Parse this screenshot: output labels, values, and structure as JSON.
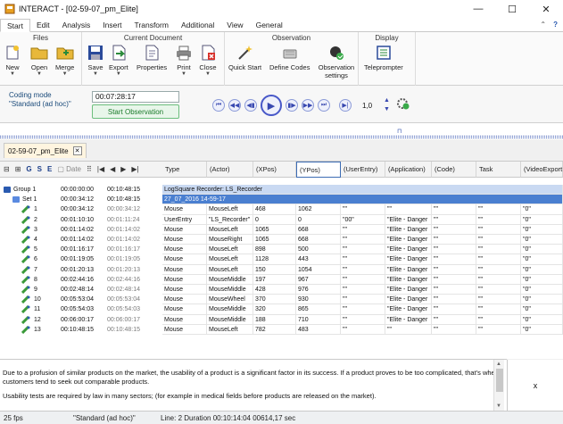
{
  "window": {
    "title": "INTERACT - [02-59-07_pm_Elite]",
    "minimize": "—",
    "maximize": "☐",
    "close": "✕"
  },
  "menu": {
    "tabs": [
      "Start",
      "Edit",
      "Analysis",
      "Insert",
      "Transform",
      "Additional",
      "View",
      "General"
    ],
    "help_icons": [
      "⌃",
      "?"
    ]
  },
  "ribbon": {
    "groups": {
      "files": "Files",
      "current_document": "Current Document",
      "observation": "Observation",
      "display": "Display"
    },
    "buttons": {
      "new": "New",
      "open": "Open",
      "merge": "Merge",
      "save": "Save",
      "export": "Export",
      "properties": "Properties",
      "print": "Print",
      "close": "Close",
      "quick_start": "Quick Start",
      "define_codes": "Define Codes",
      "observation_settings": "Observation settings",
      "teleprompter": "Teleprompter"
    }
  },
  "playback": {
    "coding_mode_label": "Coding mode",
    "coding_mode_value": "\"Standard (ad hoc)\"",
    "time": "00:07:28:17",
    "start_observation": "Start Observation",
    "speed": "1,0"
  },
  "document_tab": {
    "name": "02-59-07_pm_Elite"
  },
  "grid": {
    "toolbar": {
      "date_label": "Date"
    },
    "columns": [
      "Type",
      "(Actor)",
      "(XPos)",
      "(YPos)",
      "(UserEntry)",
      "(Application)",
      "(Code)",
      "Task",
      "(VideoExport"
    ],
    "group_row": {
      "label": "Group 1",
      "start": "00:00:00:00",
      "end": "00:10:48:15",
      "text": "LogSquare Recorder: LS_Recorder"
    },
    "set_row": {
      "label": "Set 1",
      "start": "00:00:34:12",
      "end": "00:10:48:15",
      "text": "27_07_2016 14-59-17"
    },
    "rows": [
      {
        "n": "1",
        "start": "00:00:34:12",
        "end": "00:00:34:12",
        "cells": [
          "Mouse",
          "MouseLeft",
          "468",
          "1062",
          "\"\"",
          "\"\"",
          "\"\"",
          "\"\"",
          "\"0\""
        ]
      },
      {
        "n": "2",
        "start": "00:01:10:10",
        "end": "00:01:11:24",
        "cells": [
          "UserEntry",
          "\"LS_Recorder\"",
          "0",
          "0",
          "\"00\"",
          "\"Elite - Danger",
          "\"\"",
          "\"\"",
          "\"0\""
        ]
      },
      {
        "n": "3",
        "start": "00:01:14:02",
        "end": "00:01:14:02",
        "cells": [
          "Mouse",
          "MouseLeft",
          "1065",
          "668",
          "\"\"",
          "\"Elite - Danger",
          "\"\"",
          "\"\"",
          "\"0\""
        ]
      },
      {
        "n": "4",
        "start": "00:01:14:02",
        "end": "00:01:14:02",
        "cells": [
          "Mouse",
          "MouseRight",
          "1065",
          "668",
          "\"\"",
          "\"Elite - Danger",
          "\"\"",
          "\"\"",
          "\"0\""
        ]
      },
      {
        "n": "5",
        "start": "00:01:16:17",
        "end": "00:01:16:17",
        "cells": [
          "Mouse",
          "MouseLeft",
          "898",
          "500",
          "\"\"",
          "\"Elite - Danger",
          "\"\"",
          "\"\"",
          "\"0\""
        ]
      },
      {
        "n": "6",
        "start": "00:01:19:05",
        "end": "00:01:19:05",
        "cells": [
          "Mouse",
          "MouseLeft",
          "1128",
          "443",
          "\"\"",
          "\"Elite - Danger",
          "\"\"",
          "\"\"",
          "\"0\""
        ]
      },
      {
        "n": "7",
        "start": "00:01:20:13",
        "end": "00:01:20:13",
        "cells": [
          "Mouse",
          "MouseLeft",
          "150",
          "1054",
          "\"\"",
          "\"Elite - Danger",
          "\"\"",
          "\"\"",
          "\"0\""
        ]
      },
      {
        "n": "8",
        "start": "00:02:44:16",
        "end": "00:02:44:16",
        "cells": [
          "Mouse",
          "MouseMiddle",
          "197",
          "967",
          "\"\"",
          "\"Elite - Danger",
          "\"\"",
          "\"\"",
          "\"0\""
        ]
      },
      {
        "n": "9",
        "start": "00:02:48:14",
        "end": "00:02:48:14",
        "cells": [
          "Mouse",
          "MouseMiddle",
          "428",
          "976",
          "\"\"",
          "\"Elite - Danger",
          "\"\"",
          "\"\"",
          "\"0\""
        ]
      },
      {
        "n": "10",
        "start": "00:05:53:04",
        "end": "00:05:53:04",
        "cells": [
          "Mouse",
          "MouseWheel",
          "370",
          "930",
          "\"\"",
          "\"Elite - Danger",
          "\"\"",
          "\"\"",
          "\"0\""
        ]
      },
      {
        "n": "11",
        "start": "00:05:54:03",
        "end": "00:05:54:03",
        "cells": [
          "Mouse",
          "MouseMiddle",
          "320",
          "865",
          "\"\"",
          "\"Elite - Danger",
          "\"\"",
          "\"\"",
          "\"0\""
        ]
      },
      {
        "n": "12",
        "start": "00:06:00:17",
        "end": "00:06:00:17",
        "cells": [
          "Mouse",
          "MouseMiddle",
          "188",
          "710",
          "\"\"",
          "\"Elite - Danger",
          "\"\"",
          "\"\"",
          "\"0\""
        ]
      },
      {
        "n": "13",
        "start": "00:10:48:15",
        "end": "00:10:48:15",
        "cells": [
          "Mouse",
          "MouseLeft",
          "782",
          "483",
          "\"\"",
          "\"\"",
          "\"\"",
          "\"\"",
          "\"0\""
        ]
      }
    ]
  },
  "notes": {
    "p1": "Due to a profusion of similar products on the market, the usability of a product is a significant factor in its success. If a product proves to be too complicated, that's when customers tend to seek out comparable products.",
    "p2": "Usability tests are required by law in many sectors; (for example in medical fields before products are released on the market).",
    "close": "x"
  },
  "status": {
    "fps": "25 fps",
    "mode": "\"Standard (ad hoc)\"",
    "line": "Line: 2  Duration 00:10:14:04  00614,17 sec"
  },
  "colors": {
    "accent": "#3c5ab4",
    "set_row": "#4a7fd0",
    "group_row": "#c9d9f2",
    "start_green": "#1a7a2a"
  }
}
